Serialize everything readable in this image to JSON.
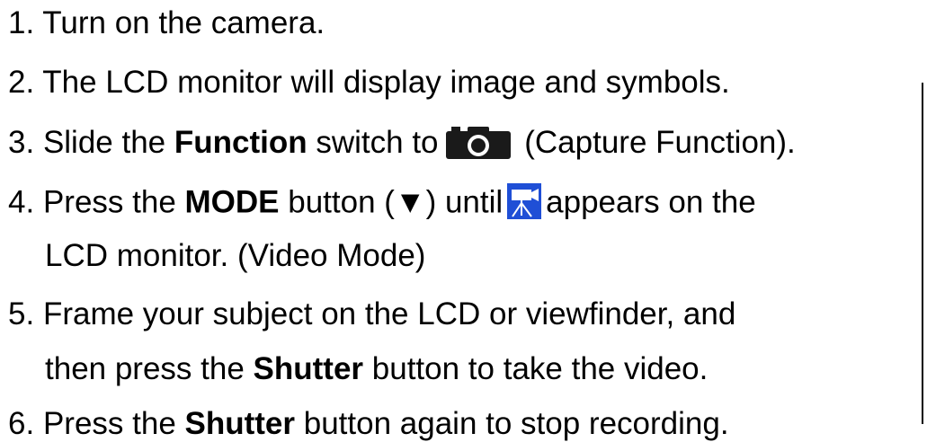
{
  "steps": [
    {
      "num": "1.",
      "text": "Turn on the camera."
    },
    {
      "num": "2.",
      "text": "The LCD monitor will display image and symbols."
    },
    {
      "num": "3.",
      "pre": "Slide the ",
      "bold": "Function",
      "post": " switch to",
      "icon": "camera-icon",
      "after": " (Capture Function)."
    },
    {
      "num": "4.",
      "pre": "Press the ",
      "bold": "MODE",
      "post": " button (▼) until",
      "icon": "video-camera-icon",
      "after": "appears on the",
      "cont": "LCD monitor. (Video Mode)"
    },
    {
      "num": "5.",
      "text": "Frame your subject on the LCD or viewfinder, and",
      "cont_pre": "then press the ",
      "cont_bold": "Shutter",
      "cont_post": " button to take the video."
    },
    {
      "num": "6.",
      "pre": "Press the ",
      "bold": "Shutter",
      "post": " button again to stop recording."
    }
  ],
  "colors": {
    "text": "#000000",
    "camera_icon": "#1a1a1a",
    "video_icon_bg": "#1f4fd6",
    "video_icon_fg": "#ffffff"
  }
}
